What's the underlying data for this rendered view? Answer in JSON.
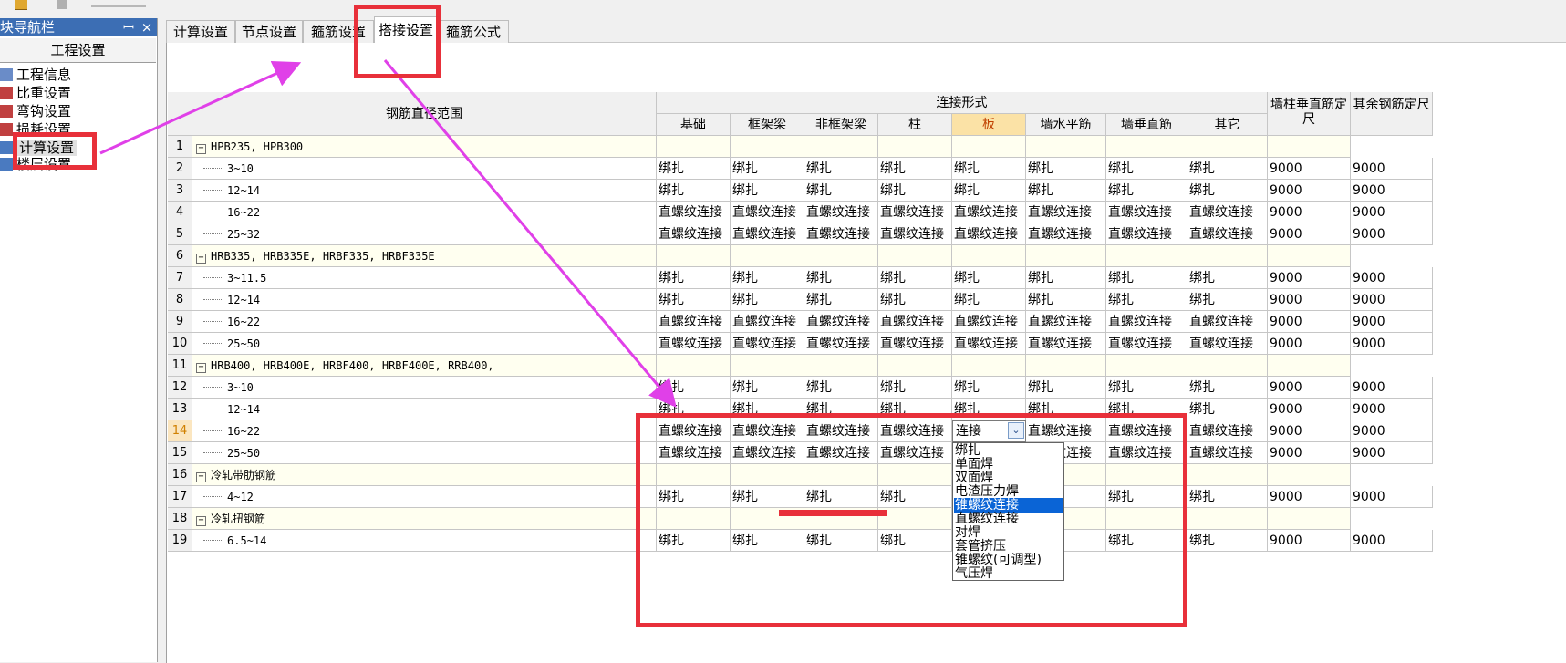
{
  "nav": {
    "title": "块导航栏",
    "pin": "ꟷ",
    "close": "×",
    "header": "工程设置",
    "items": [
      "工程信息",
      "比重设置",
      "弯钩设置",
      "损耗设置",
      "计算设置",
      "楼层设置"
    ]
  },
  "tabs": [
    "计算设置",
    "节点设置",
    "箍筋设置",
    "搭接设置",
    "箍筋公式"
  ],
  "grid": {
    "header_range": "钢筋直径范围",
    "header_group": "连接形式",
    "columns": [
      "基础",
      "框架梁",
      "非框架梁",
      "柱",
      "板",
      "墙水平筋",
      "墙垂直筋",
      "其它"
    ],
    "col_wall_len": "墙柱垂直筋定尺",
    "col_other_len": "其余钢筋定尺",
    "rows": [
      {
        "n": "1",
        "group": true,
        "label": "HPB235, HPB300"
      },
      {
        "n": "2",
        "label": "3~10",
        "vals": [
          "绑扎",
          "绑扎",
          "绑扎",
          "绑扎",
          "绑扎",
          "绑扎",
          "绑扎",
          "绑扎"
        ],
        "len1": "9000",
        "len2": "9000"
      },
      {
        "n": "3",
        "label": "12~14",
        "vals": [
          "绑扎",
          "绑扎",
          "绑扎",
          "绑扎",
          "绑扎",
          "绑扎",
          "绑扎",
          "绑扎"
        ],
        "len1": "9000",
        "len2": "9000"
      },
      {
        "n": "4",
        "label": "16~22",
        "vals": [
          "直螺纹连接",
          "直螺纹连接",
          "直螺纹连接",
          "直螺纹连接",
          "直螺纹连接",
          "直螺纹连接",
          "直螺纹连接",
          "直螺纹连接"
        ],
        "len1": "9000",
        "len2": "9000"
      },
      {
        "n": "5",
        "label": "25~32",
        "vals": [
          "直螺纹连接",
          "直螺纹连接",
          "直螺纹连接",
          "直螺纹连接",
          "直螺纹连接",
          "直螺纹连接",
          "直螺纹连接",
          "直螺纹连接"
        ],
        "len1": "9000",
        "len2": "9000"
      },
      {
        "n": "6",
        "group": true,
        "label": "HRB335, HRB335E, HRBF335, HRBF335E"
      },
      {
        "n": "7",
        "label": "3~11.5",
        "vals": [
          "绑扎",
          "绑扎",
          "绑扎",
          "绑扎",
          "绑扎",
          "绑扎",
          "绑扎",
          "绑扎"
        ],
        "len1": "9000",
        "len2": "9000"
      },
      {
        "n": "8",
        "label": "12~14",
        "vals": [
          "绑扎",
          "绑扎",
          "绑扎",
          "绑扎",
          "绑扎",
          "绑扎",
          "绑扎",
          "绑扎"
        ],
        "len1": "9000",
        "len2": "9000"
      },
      {
        "n": "9",
        "label": "16~22",
        "vals": [
          "直螺纹连接",
          "直螺纹连接",
          "直螺纹连接",
          "直螺纹连接",
          "直螺纹连接",
          "直螺纹连接",
          "直螺纹连接",
          "直螺纹连接"
        ],
        "len1": "9000",
        "len2": "9000"
      },
      {
        "n": "10",
        "label": "25~50",
        "vals": [
          "直螺纹连接",
          "直螺纹连接",
          "直螺纹连接",
          "直螺纹连接",
          "直螺纹连接",
          "直螺纹连接",
          "直螺纹连接",
          "直螺纹连接"
        ],
        "len1": "9000",
        "len2": "9000"
      },
      {
        "n": "11",
        "group": true,
        "label": "HRB400, HRB400E, HRBF400, HRBF400E, RRB400,"
      },
      {
        "n": "12",
        "label": "3~10",
        "vals": [
          "绑扎",
          "绑扎",
          "绑扎",
          "绑扎",
          "绑扎",
          "绑扎",
          "绑扎",
          "绑扎"
        ],
        "len1": "9000",
        "len2": "9000"
      },
      {
        "n": "13",
        "label": "12~14",
        "vals": [
          "绑扎",
          "绑扎",
          "绑扎",
          "绑扎",
          "绑扎",
          "绑扎",
          "绑扎",
          "绑扎"
        ],
        "len1": "9000",
        "len2": "9000"
      },
      {
        "n": "14",
        "current": true,
        "label": "16~22",
        "vals": [
          "直螺纹连接",
          "直螺纹连接",
          "直螺纹连接",
          "直螺纹连接",
          "",
          "直螺纹连接",
          "直螺纹连接",
          "直螺纹连接"
        ],
        "len1": "9000",
        "len2": "9000"
      },
      {
        "n": "15",
        "label": "25~50",
        "vals": [
          "直螺纹连接",
          "直螺纹连接",
          "直螺纹连接",
          "直螺纹连接",
          "",
          "直螺纹连接",
          "直螺纹连接",
          "直螺纹连接"
        ],
        "len1": "9000",
        "len2": "9000"
      },
      {
        "n": "16",
        "group": true,
        "label": "冷轧带肋钢筋"
      },
      {
        "n": "17",
        "label": "4~12",
        "vals": [
          "绑扎",
          "绑扎",
          "绑扎",
          "绑扎",
          "",
          "绑扎",
          "绑扎",
          "绑扎"
        ],
        "len1": "9000",
        "len2": "9000"
      },
      {
        "n": "18",
        "group": true,
        "label": "冷轧扭钢筋"
      },
      {
        "n": "19",
        "label": "6.5~14",
        "vals": [
          "绑扎",
          "绑扎",
          "绑扎",
          "绑扎",
          "",
          "绑扎",
          "绑扎",
          "绑扎"
        ],
        "len1": "9000",
        "len2": "9000"
      }
    ]
  },
  "combo": {
    "value": "连接",
    "button_icon": "chevron-down-icon"
  },
  "dropdown": {
    "options": [
      "绑扎",
      "单面焊",
      "双面焊",
      "电渣压力焊",
      "锥螺纹连接",
      "直螺纹连接",
      "对焊",
      "套管挤压",
      "锥螺纹(可调型)",
      "气压焊"
    ],
    "selected": "锥螺纹连接"
  },
  "annotation_color": "#e8303a",
  "arrow_color": "#e040e8"
}
